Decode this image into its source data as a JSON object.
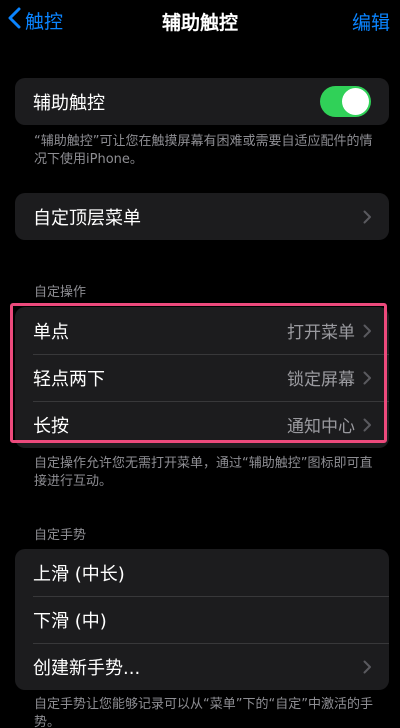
{
  "navbar": {
    "back_label": "触控",
    "title": "辅助触控",
    "edit_label": "编辑"
  },
  "assistive_touch": {
    "label": "辅助触控",
    "toggle_on": true,
    "footer": "“辅助触控”可让您在触摸屏幕有困难或需要自适应配件的情况下使用iPhone。"
  },
  "customize_top_menu": {
    "label": "自定顶层菜单"
  },
  "custom_actions": {
    "header": "自定操作",
    "items": [
      {
        "label": "单点",
        "value": "打开菜单"
      },
      {
        "label": "轻点两下",
        "value": "锁定屏幕"
      },
      {
        "label": "长按",
        "value": "通知中心"
      }
    ],
    "footer": "自定操作允许您无需打开菜单，通过“辅助触控”图标即可直接进行互动。"
  },
  "custom_gestures": {
    "header": "自定手势",
    "items": [
      {
        "label": "上滑 (中长)"
      },
      {
        "label": "下滑 (中)"
      },
      {
        "label": "创建新手势..."
      }
    ],
    "footer": "自定手势让您能够记录可以从“菜单”下的“自定”中激活的手势。"
  },
  "colors": {
    "accent": "#0a84ff",
    "toggle_on": "#30d158",
    "highlight": "#ec4a7c",
    "cell_bg": "#1c1c1e"
  }
}
